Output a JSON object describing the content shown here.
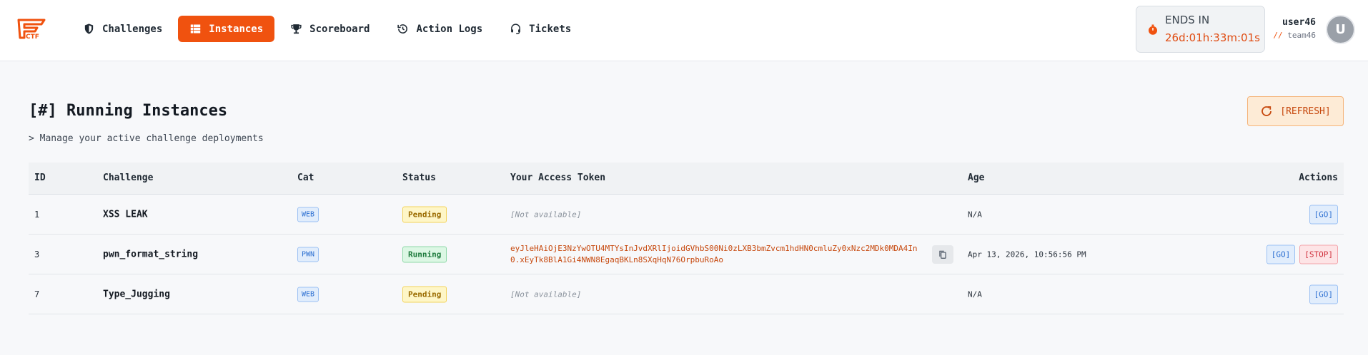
{
  "logo": {
    "text": "CTF",
    "color": "#f0520f"
  },
  "nav": {
    "items": [
      {
        "label": "Challenges",
        "icon": "shield-icon",
        "active": false
      },
      {
        "label": "Instances",
        "icon": "list-icon",
        "active": true
      },
      {
        "label": "Scoreboard",
        "icon": "trophy-icon",
        "active": false
      },
      {
        "label": "Action Logs",
        "icon": "history-icon",
        "active": false
      },
      {
        "label": "Tickets",
        "icon": "headset-icon",
        "active": false
      }
    ],
    "accent": "#f0520f"
  },
  "timer": {
    "label": "ENDS IN",
    "value": "26d:01h:33m:01s"
  },
  "user": {
    "name": "user46",
    "team_prefix": "//",
    "team": "team46",
    "avatar_letter": "U"
  },
  "page": {
    "title": "[#] Running Instances",
    "subtitle": "> Manage your active challenge deployments",
    "refresh_label": "[REFRESH]"
  },
  "table": {
    "columns": [
      "ID",
      "Challenge",
      "Cat",
      "Status",
      "Your Access Token",
      "Age",
      "Actions"
    ],
    "rows": [
      {
        "id": "1",
        "challenge": "XSS LEAK",
        "cat": "WEB",
        "status": "Pending",
        "token": "[Not available]",
        "age": "N/A",
        "actions": [
          "[GO]"
        ]
      },
      {
        "id": "3",
        "challenge": "pwn_format_string",
        "cat": "PWN",
        "status": "Running",
        "token": "eyJleHAiOjE3NzYwOTU4MTYsInJvdXRlIjoidGVhbS00Ni0zLXB3bmZvcm1hdHN0cmluZy0xNzc2MDk0MDA4In0.xEyTk8BlA1Gi4NWN8EgaqBKLn8SXqHqN76OrpbuRoAo",
        "age": "Apr 13, 2026, 10:56:56 PM",
        "actions": [
          "[GO]",
          "[STOP]"
        ]
      },
      {
        "id": "7",
        "challenge": "Type_Jugging",
        "cat": "WEB",
        "status": "Pending",
        "token": "[Not available]",
        "age": "N/A",
        "actions": [
          "[GO]"
        ]
      }
    ]
  }
}
